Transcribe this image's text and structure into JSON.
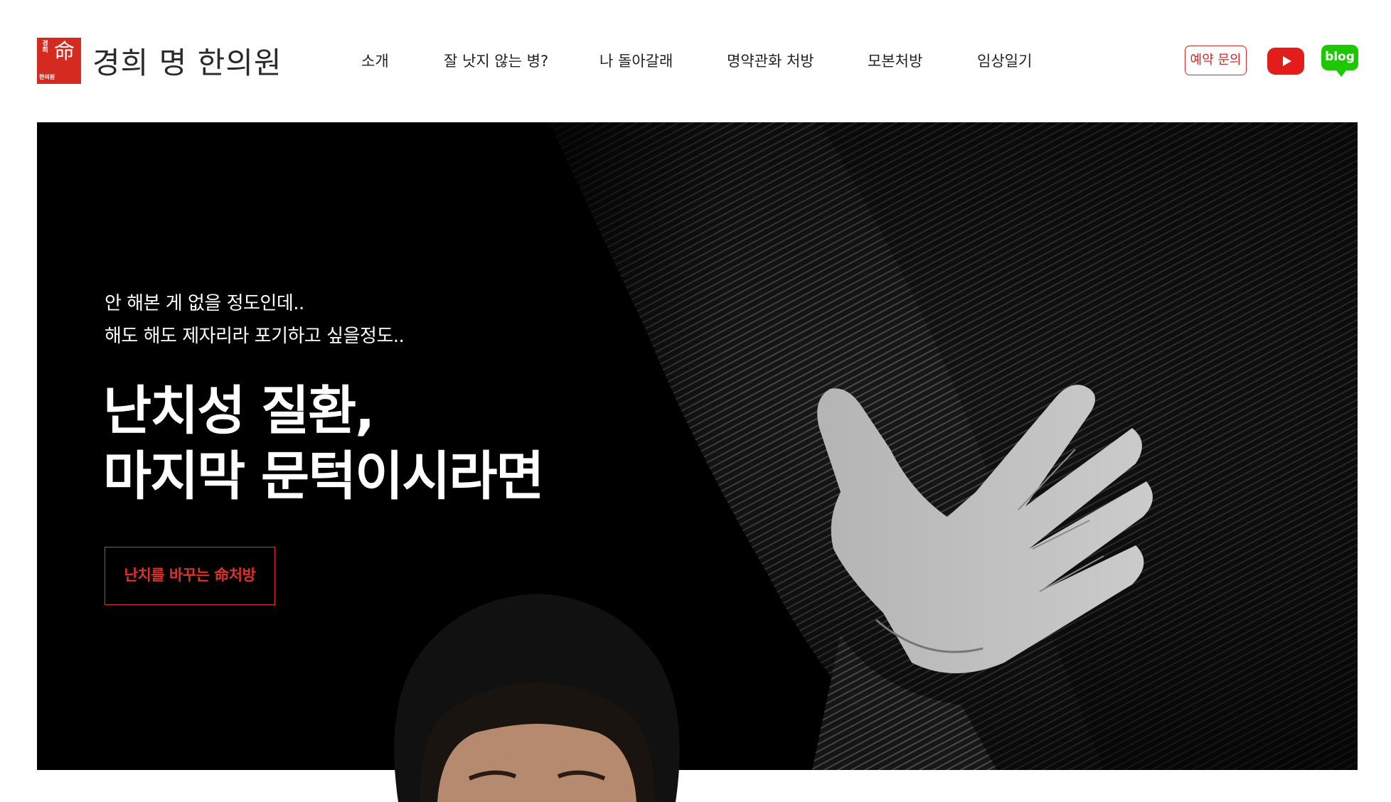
{
  "logo": {
    "seal_top_text": "경희",
    "seal_glyph": "命",
    "seal_bottom_text": "한의원",
    "text": "경희 명 한의원",
    "brand_color": "#d42a20"
  },
  "nav": {
    "items": [
      {
        "label": "소개"
      },
      {
        "label": "잘 낫지 않는 병?"
      },
      {
        "label": "나 돌아갈래"
      },
      {
        "label": "명약관화 처방"
      },
      {
        "label": "모본처방"
      },
      {
        "label": "임상일기"
      }
    ]
  },
  "header_actions": {
    "reserve_label": "예약 문의",
    "youtube_icon": "youtube-icon",
    "blog_label": "blog",
    "accent_color": "#d12b2b",
    "youtube_color": "#e31d1a",
    "blog_color": "#1ec800"
  },
  "hero": {
    "sub_line_1": "안 해본 게 없을 정도인데..",
    "sub_line_2": "해도 해도 제자리라 포기하고 싶을정도..",
    "title_line_1": "난치성 질환,",
    "title_line_2": "마지막 문턱이시라면",
    "cta_label": "난치를 바꾸는 命처방",
    "cta_color": "#e0302a",
    "background_image": "black-and-white hand on chest photo",
    "portrait_image": "doctor portrait"
  }
}
